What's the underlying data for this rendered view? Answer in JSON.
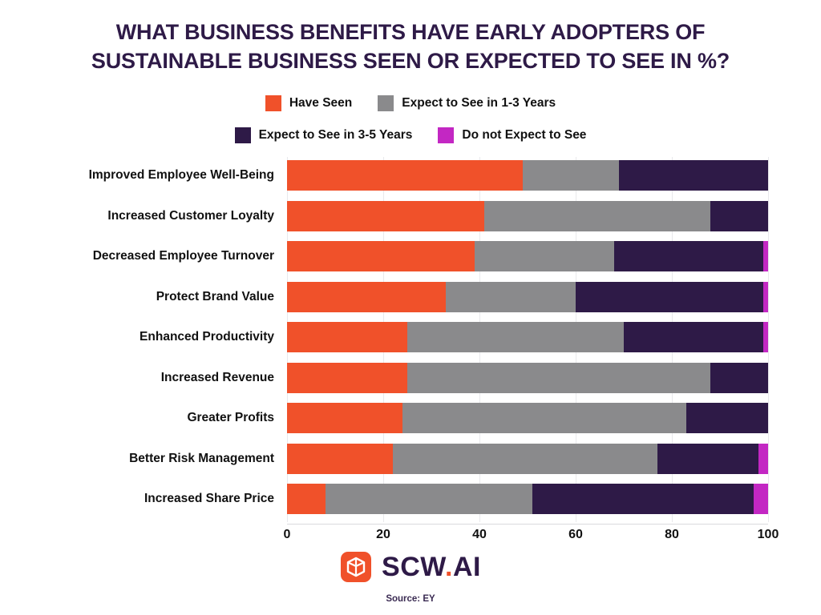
{
  "title": {
    "line1": "WHAT BUSINESS BENEFITS HAVE EARLY ADOPTERS OF",
    "line2": "SUSTAINABLE BUSINESS SEEN OR EXPECTED TO SEE IN %?"
  },
  "footer": {
    "brand_name": "SCW",
    "brand_dot": ".",
    "brand_suffix": "AI",
    "logo_icon": "cube-logo-icon",
    "source": "Source: EY"
  },
  "colors": {
    "have_seen": "#f0512a",
    "expect_1_3": "#8a8a8c",
    "expect_3_5": "#2e1a47",
    "do_not_expect": "#c327c3",
    "title": "#2e1a47",
    "grid": "#e9e9ec",
    "text": "#111111"
  },
  "chart_data": {
    "type": "bar",
    "orientation": "horizontal",
    "stacked": true,
    "title": "WHAT BUSINESS BENEFITS HAVE EARLY ADOPTERS OF SUSTAINABLE BUSINESS SEEN OR EXPECTED TO SEE IN %?",
    "xlabel": "",
    "ylabel": "",
    "xlim": [
      0,
      100
    ],
    "xticks": [
      "0",
      "20",
      "40",
      "60",
      "80",
      "100"
    ],
    "grid": true,
    "legend_position": "top",
    "categories": [
      "Improved Employee Well-Being",
      "Increased Customer Loyalty",
      "Decreased Employee Turnover",
      "Protect Brand Value",
      "Enhanced Productivity",
      "Increased Revenue",
      "Greater Profits",
      "Better Risk Management",
      "Increased Share Price"
    ],
    "series": [
      {
        "name": "Have Seen",
        "color": "#f0512a",
        "values": [
          49,
          41,
          39,
          33,
          25,
          25,
          24,
          22,
          8
        ]
      },
      {
        "name": "Expect to See in 1-3 Years",
        "color": "#8a8a8c",
        "values": [
          20,
          47,
          29,
          27,
          45,
          63,
          59,
          55,
          43
        ]
      },
      {
        "name": "Expect to See in 3-5 Years",
        "color": "#2e1a47",
        "values": [
          31,
          12,
          31,
          39,
          29,
          12,
          17,
          21,
          46
        ]
      },
      {
        "name": "Do not Expect to See",
        "color": "#c327c3",
        "values": [
          0,
          0,
          1,
          1,
          1,
          0,
          0,
          2,
          3
        ]
      }
    ]
  },
  "legend": {
    "items": [
      {
        "label": "Have Seen",
        "color": "#f0512a"
      },
      {
        "label": "Expect to See in 1-3 Years",
        "color": "#8a8a8c"
      },
      {
        "label": "Expect to See in 3-5 Years",
        "color": "#2e1a47"
      },
      {
        "label": "Do not Expect to See",
        "color": "#c327c3"
      }
    ]
  }
}
